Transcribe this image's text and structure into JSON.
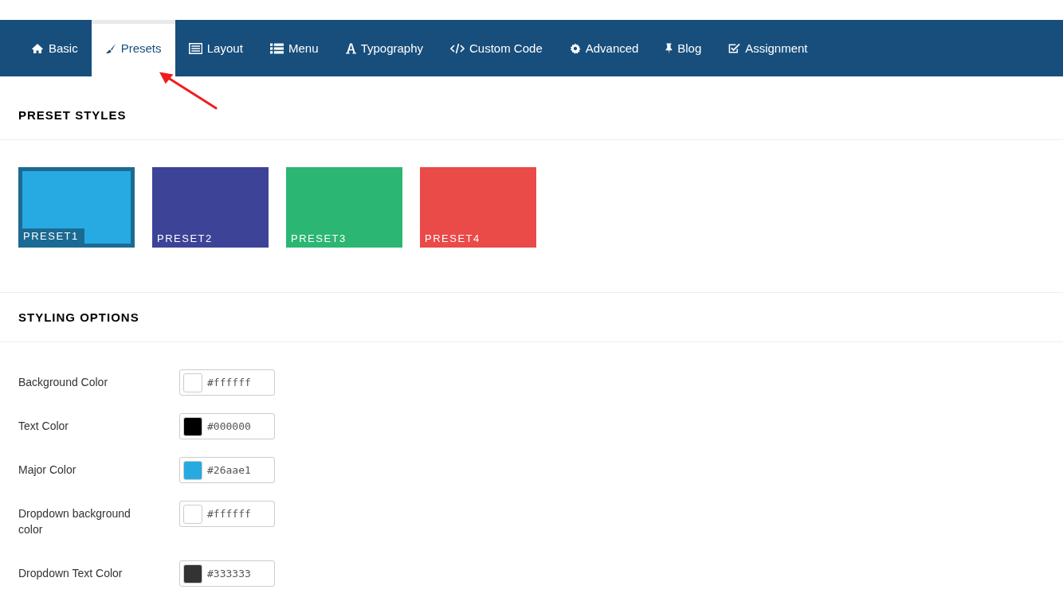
{
  "tabs": [
    {
      "label": "Basic",
      "kind": "home",
      "selected": false
    },
    {
      "label": "Presets",
      "kind": "brush",
      "selected": true
    },
    {
      "label": "Layout",
      "kind": "layout",
      "selected": false
    },
    {
      "label": "Menu",
      "kind": "list",
      "selected": false
    },
    {
      "label": "Typography",
      "kind": "font",
      "selected": false
    },
    {
      "label": "Custom Code",
      "kind": "code",
      "selected": false
    },
    {
      "label": "Advanced",
      "kind": "gear",
      "selected": false
    },
    {
      "label": "Blog",
      "kind": "pin",
      "selected": false
    },
    {
      "label": "Assignment",
      "kind": "check",
      "selected": false
    }
  ],
  "preset_styles": {
    "title": "PRESET STYLES",
    "presets": [
      {
        "label": "PRESET1",
        "color": "#27a9e1",
        "selected": true
      },
      {
        "label": "PRESET2",
        "color": "#3d4396",
        "selected": false
      },
      {
        "label": "PRESET3",
        "color": "#2bb673",
        "selected": false
      },
      {
        "label": "PRESET4",
        "color": "#ea4a48",
        "selected": false
      }
    ]
  },
  "styling_options": {
    "title": "STYLING OPTIONS",
    "fields": [
      {
        "label": "Background Color",
        "value": "#ffffff",
        "color": "#ffffff"
      },
      {
        "label": "Text Color",
        "value": "#000000",
        "color": "#000000"
      },
      {
        "label": "Major Color",
        "value": "#26aae1",
        "color": "#26aae1"
      },
      {
        "label": "Dropdown background color",
        "value": "#ffffff",
        "color": "#ffffff"
      },
      {
        "label": "Dropdown Text Color",
        "value": "#333333",
        "color": "#333333"
      }
    ]
  }
}
